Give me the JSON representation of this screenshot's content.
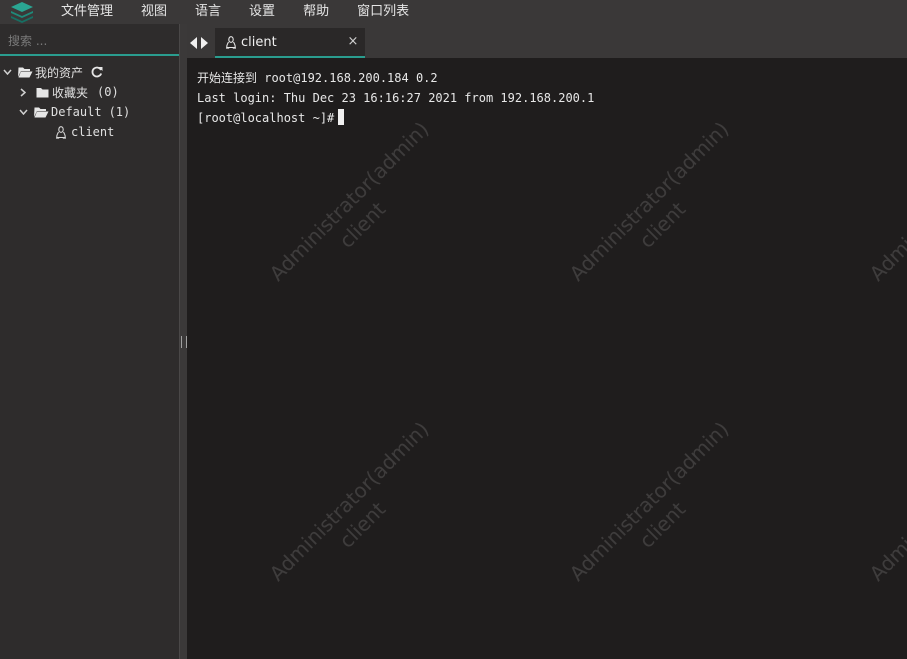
{
  "menubar": {
    "items": [
      "文件管理",
      "视图",
      "语言",
      "设置",
      "帮助",
      "窗口列表"
    ]
  },
  "sidebar": {
    "search_placeholder": "搜索 ...",
    "tree": {
      "root_label": "我的资产",
      "favorites_label": "收藏夹",
      "favorites_count": "(0)",
      "group_label": "Default",
      "group_count": "(1)",
      "host_label": "client"
    }
  },
  "tabs": [
    {
      "label": "client",
      "close": "×"
    }
  ],
  "terminal": {
    "lines": [
      "开始连接到 root@192.168.200.184 0.2",
      "Last login: Thu Dec 23 16:16:27 2021 from 192.168.200.1",
      "[root@localhost ~]#"
    ]
  },
  "watermark": {
    "line1": "Administrator(admin)",
    "line2": "client"
  },
  "colors": {
    "accent": "#2a9d8f",
    "menubar_bg": "#3a3838",
    "sidebar_bg": "#2e2c2c",
    "terminal_bg": "#1f1d1d"
  }
}
